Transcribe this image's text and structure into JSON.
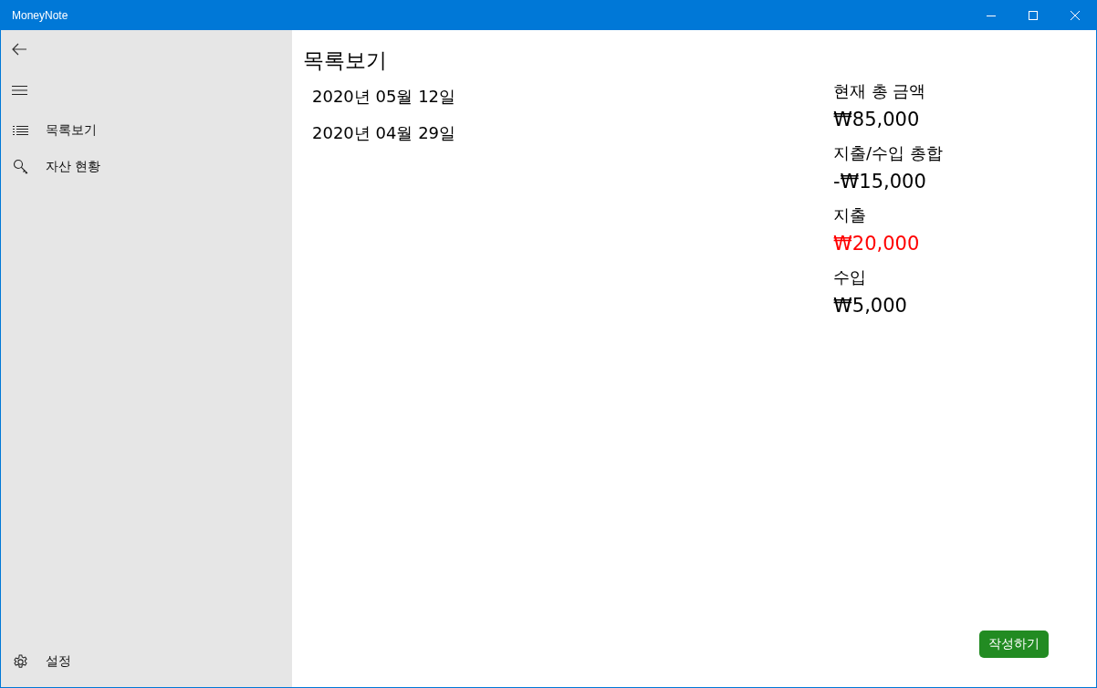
{
  "window": {
    "title": "MoneyNote"
  },
  "sidebar": {
    "items": [
      {
        "label": "목록보기"
      },
      {
        "label": "자산 현황"
      }
    ],
    "footer": {
      "label": "설정"
    }
  },
  "page": {
    "title": "목록보기"
  },
  "dates": [
    "2020년 05월 12일",
    "2020년 04월 29일"
  ],
  "summary": [
    {
      "label": "현재 총 금액",
      "value": "₩85,000",
      "color": "#000000"
    },
    {
      "label": "지출/수입 총합",
      "value": "-₩15,000",
      "color": "#000000"
    },
    {
      "label": "지출",
      "value": "₩20,000",
      "color": "#ff0000"
    },
    {
      "label": "수입",
      "value": "₩5,000",
      "color": "#000000"
    }
  ],
  "write_button": "작성하기"
}
